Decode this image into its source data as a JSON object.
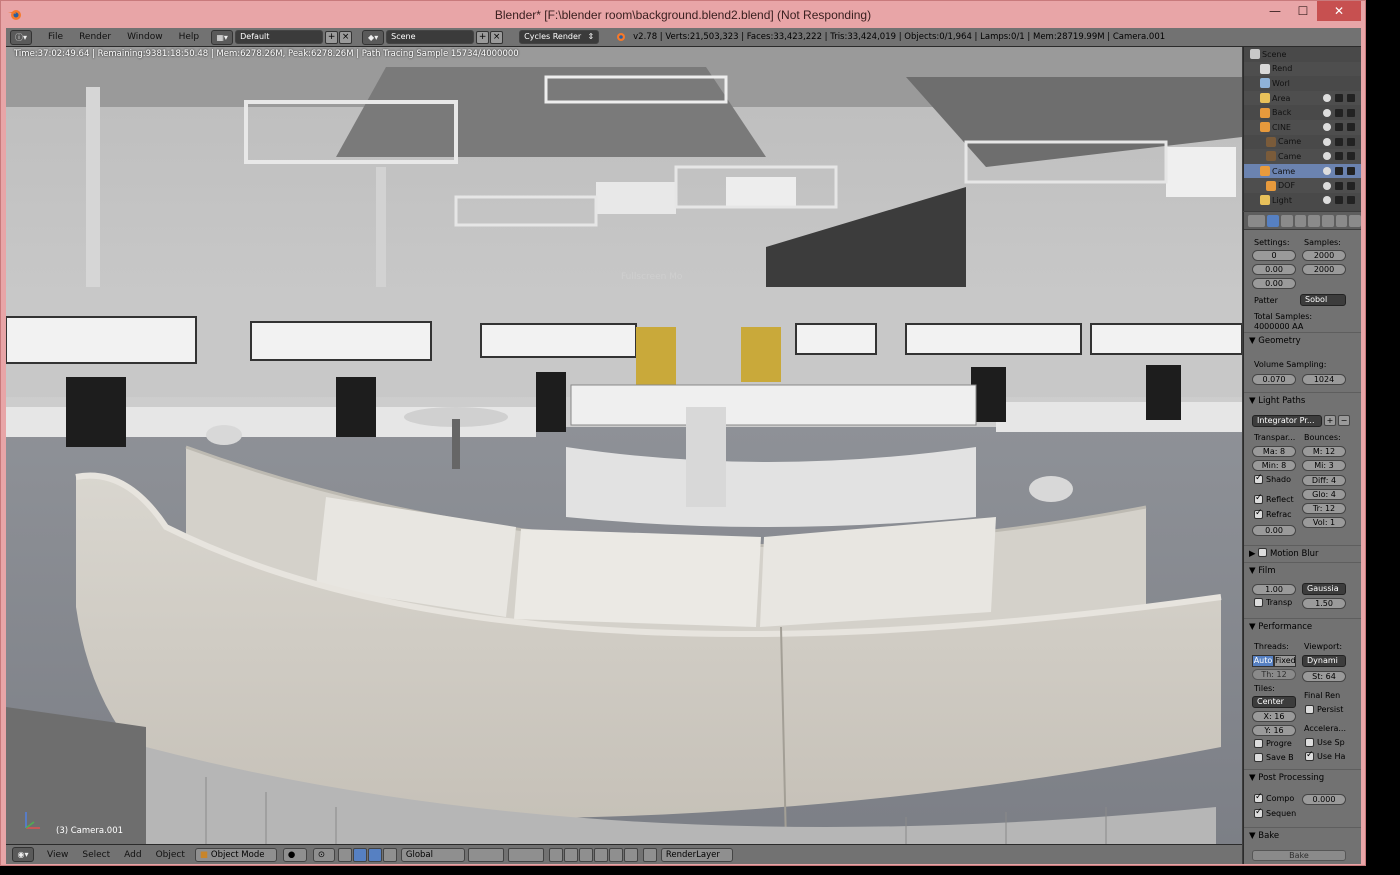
{
  "window": {
    "title": "Blender* [F:\\blender room\\background.blend2.blend] (Not Responding)",
    "minimize": "—",
    "maximize": "☐",
    "close": "✕"
  },
  "info_header": {
    "menus": [
      "File",
      "Render",
      "Window",
      "Help"
    ],
    "layout": "Default",
    "scene": "Scene",
    "engine": "Cycles Render",
    "stats": "v2.78 | Verts:21,503,323 | Faces:33,423,222 | Tris:33,424,019 | Objects:0/1,964 | Lamps:0/1 | Mem:28719.99M | Camera.001"
  },
  "viewport": {
    "render_status": "Time:37:02:49.64 | Remaining:9381:18:50.48 | Mem:6278.26M, Peak:6278.26M | Path Tracing Sample 15734/4000000",
    "camera_label": "(3) Camera.001",
    "faint_label": "Fullscreen Mo"
  },
  "view_header": {
    "menus": [
      "View",
      "Select",
      "Add",
      "Object"
    ],
    "mode": "Object Mode",
    "orientation": "Global",
    "render_layer": "RenderLayer"
  },
  "outliner": {
    "items": [
      {
        "name": "Scene",
        "color": "#c8c8c8"
      },
      {
        "name": "Rend",
        "color": "#d9d9d9"
      },
      {
        "name": "Worl",
        "color": "#8fb3d9"
      },
      {
        "name": "Area",
        "color": "#e8c15a"
      },
      {
        "name": "Back",
        "color": "#e89a3c"
      },
      {
        "name": "CINE",
        "color": "#e89a3c"
      },
      {
        "name": "Came",
        "color": "#7a5b3a"
      },
      {
        "name": "Came",
        "color": "#7a5b3a"
      },
      {
        "name": "Came",
        "color": "#e89a3c"
      },
      {
        "name": "DOF",
        "color": "#e89a3c"
      },
      {
        "name": "Light",
        "color": "#e8c15a"
      }
    ]
  },
  "properties": {
    "settings_label": "Settings:",
    "samples_label": "Samples:",
    "seed": "0",
    "clamp_direct": "0.00",
    "clamp_indirect": "0.00",
    "render_samples": "2000",
    "preview_samples": "2000",
    "pattern_label": "Patter",
    "pattern": "Sobol",
    "total_samples_label": "Total Samples:",
    "total_samples": "4000000 AA",
    "geometry": "Geometry",
    "volume_sampling": "Volume Sampling:",
    "vol_step": "0.070",
    "vol_max": "1024",
    "light_paths": "Light Paths",
    "integrator": "Integrator Pr...",
    "transparency": "Transpar...",
    "bounces": "Bounces:",
    "trans_max": "Ma: 8",
    "trans_min": "Min: 8",
    "bounce_max": "M: 12",
    "bounce_min": "Mi: 3",
    "shadows": "Shado",
    "diff": "Diff: 4",
    "glos": "Glo: 4",
    "reflect": "Reflect",
    "tr": "Tr: 12",
    "refract": "Refrac",
    "vol": "Vol: 1",
    "filter_glossy": "0.00",
    "motion_blur": "Motion Blur",
    "film": "Film",
    "exposure": "1.00",
    "filter": "Gaussia",
    "transparent": "Transp",
    "filter_width": "1.50",
    "performance": "Performance",
    "threads": "Threads:",
    "viewport_label": "Viewport:",
    "auto": "Auto",
    "fixed": "Fixed",
    "dynamic": "Dynami",
    "th": "Th: 12",
    "st": "St: 64",
    "tiles": "Tiles:",
    "final_render": "Final Ren",
    "center": "Center",
    "persist": "Persist",
    "tile_x": "X: 16",
    "tile_y": "Y: 16",
    "acceleration": "Accelera...",
    "progressive": "Progre",
    "use_sp": "Use Sp",
    "save_b": "Save B",
    "use_ha": "Use Ha",
    "post_processing": "Post Processing",
    "compositing": "Compo",
    "dither": "0.000",
    "sequencer": "Sequen",
    "bake": "Bake",
    "bake_btn": "Bake"
  }
}
